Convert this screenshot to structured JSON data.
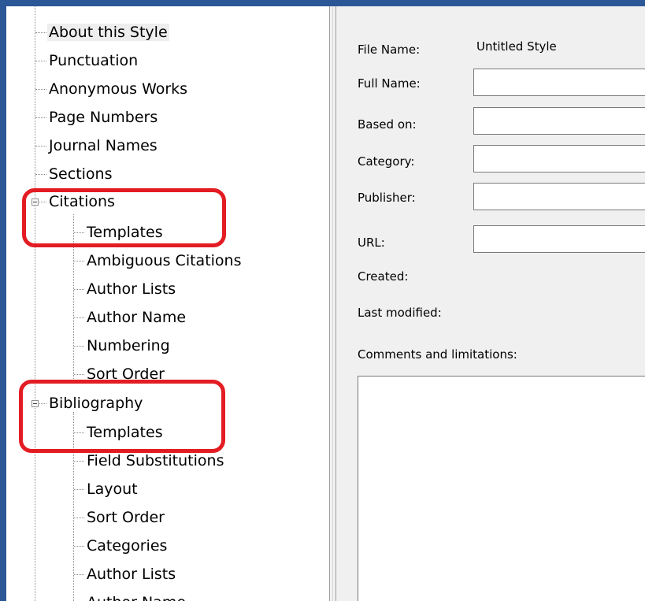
{
  "tree": {
    "items": [
      {
        "label": "About this Style",
        "selected": true
      },
      {
        "label": "Punctuation"
      },
      {
        "label": "Anonymous Works"
      },
      {
        "label": "Page Numbers"
      },
      {
        "label": "Journal Names"
      },
      {
        "label": "Sections"
      },
      {
        "label": "Citations",
        "expanded": true
      },
      {
        "label": "Templates"
      },
      {
        "label": "Ambiguous Citations"
      },
      {
        "label": "Author Lists"
      },
      {
        "label": "Author Name"
      },
      {
        "label": "Numbering"
      },
      {
        "label": "Sort Order"
      },
      {
        "label": "Bibliography",
        "expanded": true
      },
      {
        "label": "Templates"
      },
      {
        "label": "Field Substitutions"
      },
      {
        "label": "Layout"
      },
      {
        "label": "Sort Order"
      },
      {
        "label": "Categories"
      },
      {
        "label": "Author Lists"
      },
      {
        "label": "Author Name"
      }
    ]
  },
  "form": {
    "file_name_label": "File Name:",
    "file_name_value": "Untitled Style",
    "full_name_label": "Full Name:",
    "full_name_value": "",
    "based_on_label": "Based on:",
    "based_on_value": "",
    "category_label": "Category:",
    "category_value": "",
    "publisher_label": "Publisher:",
    "publisher_value": "",
    "url_label": "URL:",
    "url_value": "",
    "created_label": "Created:",
    "last_modified_label": "Last modified:",
    "comments_label": "Comments and limitations:",
    "comments_value": ""
  },
  "colors": {
    "window_border": "#2b5797",
    "highlight": "#e31c23",
    "panel_bg": "#f0f0f0"
  }
}
